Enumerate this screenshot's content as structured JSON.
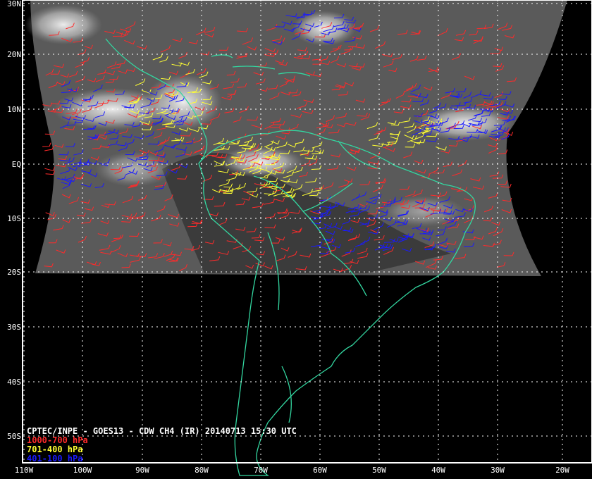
{
  "map": {
    "title": "CPTEC/INPE - GOES13 - CDW CH4 (IR) 20140713 15:30 UTC",
    "legend": [
      {
        "label": "1000-700 hPa",
        "color": "#ff2a2a"
      },
      {
        "label": "701-400 hPa",
        "color": "#ffff33"
      },
      {
        "label": "401-100 hPa",
        "color": "#1a1aff"
      }
    ],
    "lat_labels": [
      "30N",
      "20N",
      "10N",
      "EQ",
      "10S",
      "20S",
      "30S",
      "40S",
      "50S"
    ],
    "lon_labels": [
      "110W",
      "100W",
      "90W",
      "80W",
      "70W",
      "60W",
      "50W",
      "40W",
      "30W",
      "20W"
    ],
    "coast_color": "#33d6a0",
    "grid_color": "#ffffff",
    "frame_color": "#ffffff"
  }
}
